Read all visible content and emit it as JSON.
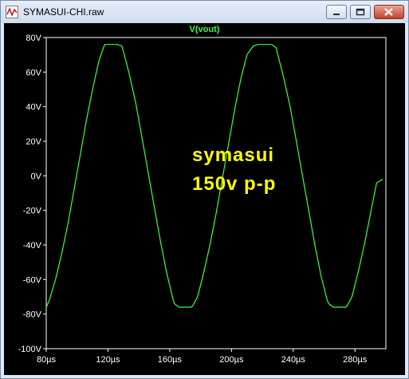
{
  "window": {
    "title": "SYMASUI-CHI.raw",
    "icons": [
      "waveform-app-icon",
      "minimize-icon",
      "restore-icon",
      "close-icon"
    ]
  },
  "plot": {
    "trace_label": "V(vout)",
    "annotation": {
      "line1": "symasui",
      "line2": "150v p-p"
    },
    "colors": {
      "background": "#000000",
      "trace": "#3cff3c",
      "annotation": "#ffff00",
      "axis_text": "#ffffff"
    }
  },
  "chart_data": {
    "type": "line",
    "title": "V(vout)",
    "xlabel": "",
    "ylabel": "",
    "xlim": [
      80,
      300
    ],
    "ylim": [
      -100,
      80
    ],
    "x_ticks": [
      "80µs",
      "120µs",
      "160µs",
      "200µs",
      "240µs",
      "280µs"
    ],
    "y_ticks": [
      "80V",
      "60V",
      "40V",
      "20V",
      "0V",
      "-20V",
      "-40V",
      "-60V",
      "-80V",
      "-100V"
    ],
    "grid": false,
    "series": [
      {
        "name": "V(vout)",
        "x": [
          80,
          82,
          86,
          90,
          94,
          98,
          102,
          106,
          110,
          114,
          117,
          118,
          122,
          126,
          129,
          130,
          134,
          138,
          142,
          146,
          150,
          154,
          158,
          162,
          163,
          166,
          170,
          174,
          175,
          178,
          182,
          186,
          190,
          194,
          198,
          202,
          206,
          210,
          214,
          217,
          218,
          222,
          226,
          229,
          230,
          234,
          238,
          242,
          246,
          250,
          254,
          258,
          262,
          263,
          266,
          270,
          274,
          275,
          278,
          282,
          286,
          290,
          294,
          298
        ],
        "y": [
          -76,
          -72,
          -60,
          -45,
          -28,
          -8,
          12,
          32,
          50,
          66,
          74,
          76,
          76,
          76,
          75,
          72,
          58,
          42,
          22,
          2,
          -18,
          -38,
          -56,
          -71,
          -74,
          -76,
          -76,
          -76,
          -75,
          -70,
          -56,
          -40,
          -22,
          -2,
          18,
          38,
          56,
          70,
          75,
          76,
          76,
          76,
          76,
          74,
          70,
          56,
          40,
          20,
          0,
          -20,
          -40,
          -58,
          -72,
          -74,
          -76,
          -76,
          -76,
          -75,
          -70,
          -56,
          -40,
          -22,
          -4,
          -2
        ]
      }
    ]
  }
}
